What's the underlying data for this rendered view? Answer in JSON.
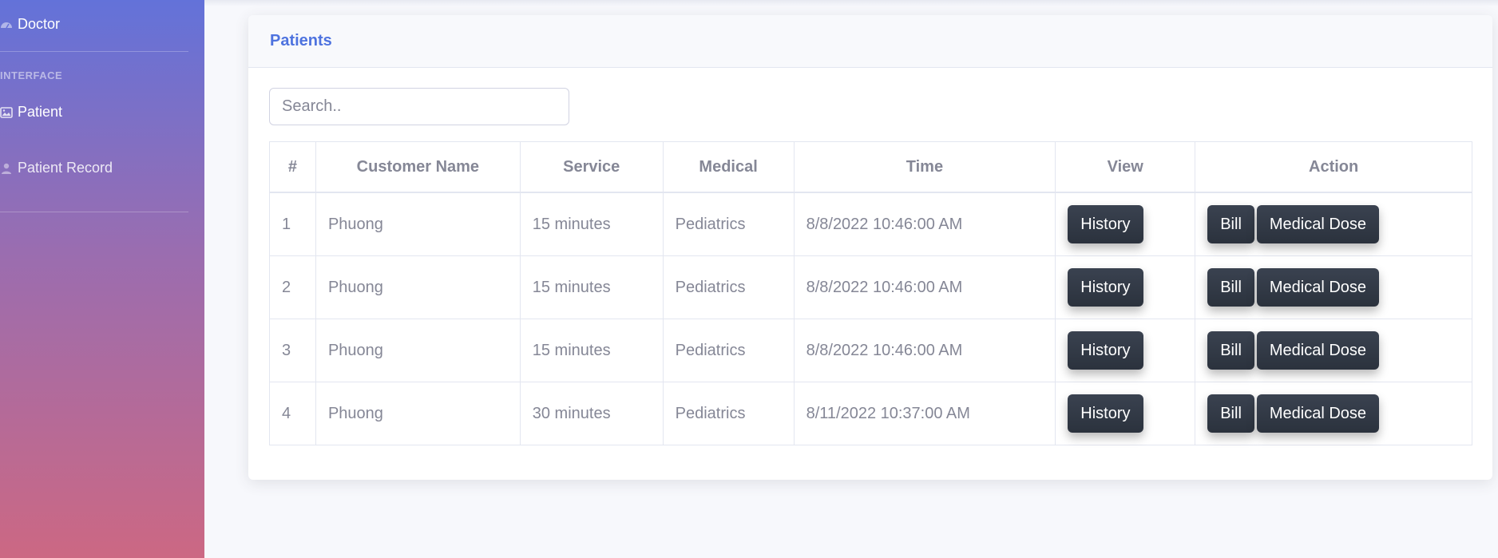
{
  "sidebar": {
    "doctor_label": "Doctor",
    "heading": "INTERFACE",
    "items": [
      {
        "label": "Patient",
        "icon": "image-icon"
      },
      {
        "label": "Patient Record",
        "icon": "user-icon"
      }
    ]
  },
  "card": {
    "title": "Patients",
    "search_placeholder": "Search.."
  },
  "table": {
    "headers": [
      "#",
      "Customer Name",
      "Service",
      "Medical",
      "Time",
      "View",
      "Action"
    ],
    "rows": [
      {
        "no": "1",
        "name": "Phuong",
        "service": "15 minutes",
        "medical": "Pediatrics",
        "time": "8/8/2022 10:46:00 AM"
      },
      {
        "no": "2",
        "name": "Phuong",
        "service": "15 minutes",
        "medical": "Pediatrics",
        "time": "8/8/2022 10:46:00 AM"
      },
      {
        "no": "3",
        "name": "Phuong",
        "service": "15 minutes",
        "medical": "Pediatrics",
        "time": "8/8/2022 10:46:00 AM"
      },
      {
        "no": "4",
        "name": "Phuong",
        "service": "30 minutes",
        "medical": "Pediatrics",
        "time": "8/11/2022 10:37:00 AM"
      }
    ],
    "view_button": "History",
    "bill_button": "Bill",
    "dose_button": "Medical Dose"
  },
  "colors": {
    "accent": "#4e73df",
    "button": "#2b323d"
  }
}
